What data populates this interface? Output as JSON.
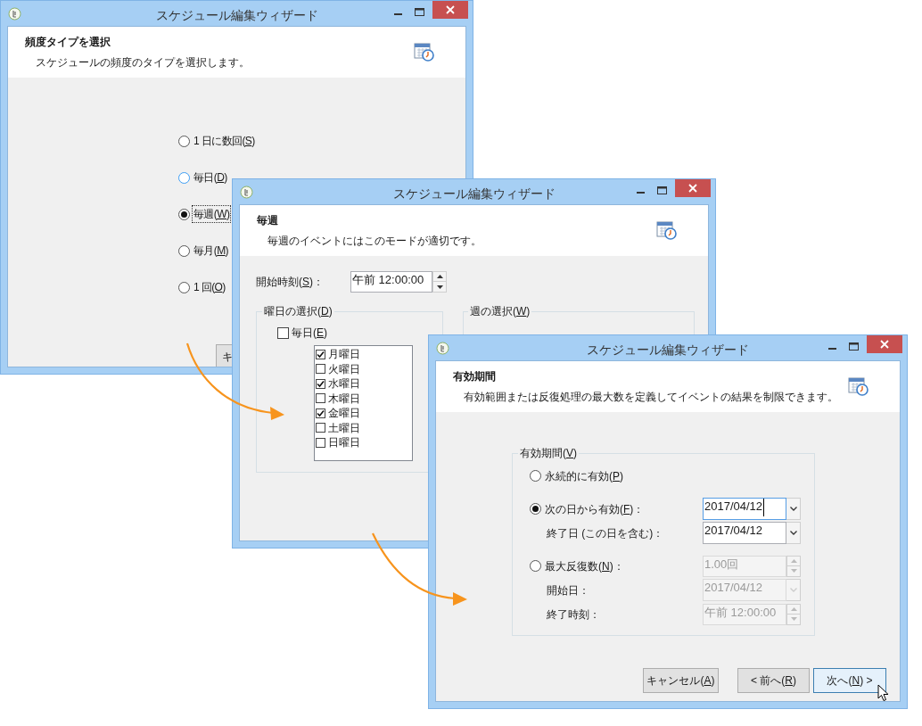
{
  "frequency_window": {
    "title": "スケジュール編集ウィザード",
    "header": {
      "title": "頻度タイプを選択",
      "subtitle": "スケジュールの頻度のタイプを選択します。"
    },
    "options": [
      {
        "label": "1 日に数回(S)",
        "selected": false,
        "hover": false,
        "focused": false
      },
      {
        "label": "毎日(D)",
        "selected": false,
        "hover": true,
        "focused": false
      },
      {
        "label": "毎週(W)",
        "selected": true,
        "hover": false,
        "focused": true
      },
      {
        "label": "毎月(M)",
        "selected": false,
        "hover": false,
        "focused": false
      },
      {
        "label": "1 回(O)",
        "selected": false,
        "hover": false,
        "focused": false
      }
    ],
    "buttons": [
      "キ"
    ]
  },
  "weekly_window": {
    "title": "スケジュール編集ウィザード",
    "header": {
      "title": "毎週",
      "subtitle": "毎週のイベントにはこのモードが適切です。"
    },
    "start_time": {
      "label": "開始時刻(S)：",
      "value": "午前 12:00:00"
    },
    "day_group": {
      "title": "曜日の選択(D)",
      "every_day": {
        "label": "毎日(E)",
        "checked": false
      },
      "days": [
        {
          "label": "月曜日",
          "checked": true
        },
        {
          "label": "火曜日",
          "checked": false
        },
        {
          "label": "水曜日",
          "checked": true
        },
        {
          "label": "木曜日",
          "checked": false
        },
        {
          "label": "金曜日",
          "checked": true
        },
        {
          "label": "土曜日",
          "checked": false
        },
        {
          "label": "日曜日",
          "checked": false
        }
      ]
    },
    "week_group": {
      "title": "週の選択(W)"
    }
  },
  "validity_window": {
    "title": "スケジュール編集ウィザード",
    "header": {
      "title": "有効期間",
      "subtitle": "有効範囲または反復処理の最大数を定義してイベントの結果を制限できます。"
    },
    "group": {
      "title": "有効期間(V)",
      "rows": [
        {
          "kind": "radio",
          "label": "永続的に有効(P)",
          "selected": false
        },
        {
          "kind": "radio",
          "label": "次の日から有効(F)：",
          "selected": true,
          "control": {
            "kind": "date",
            "value": "2017/04/12",
            "focused": true,
            "disabled": false
          }
        },
        {
          "kind": "label",
          "label": "終了日 (この日を含む)：",
          "control": {
            "kind": "date",
            "value": "2017/04/12",
            "focused": false,
            "disabled": false
          }
        },
        {
          "kind": "radio",
          "label": "最大反復数(N)：",
          "selected": false,
          "control": {
            "kind": "spinner",
            "value": "1.00回",
            "disabled": true
          }
        },
        {
          "kind": "label",
          "label": "開始日：",
          "control": {
            "kind": "date",
            "value": "2017/04/12",
            "focused": false,
            "disabled": true
          }
        },
        {
          "kind": "label",
          "label": "終了時刻：",
          "control": {
            "kind": "spinner",
            "value": "午前 12:00:00",
            "disabled": true
          }
        }
      ]
    },
    "buttons": [
      {
        "label": "キャンセル(A)",
        "default": false
      },
      {
        "label": "< 前へ(R)",
        "default": false
      },
      {
        "label": "次へ(N) >",
        "default": true
      }
    ]
  }
}
